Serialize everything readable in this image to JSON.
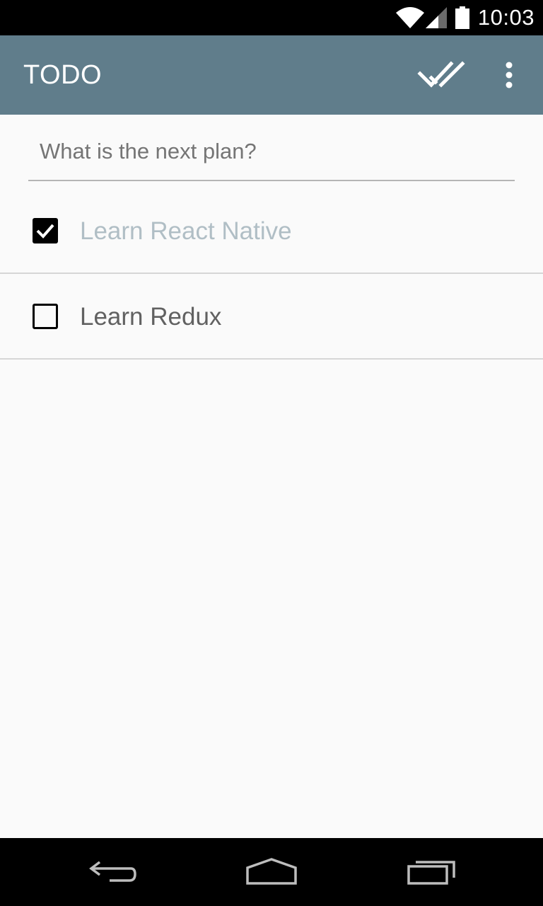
{
  "status_bar": {
    "time": "10:03",
    "icons": [
      "wifi-icon",
      "cell-signal-icon",
      "battery-icon"
    ]
  },
  "app_bar": {
    "title": "TODO",
    "actions": [
      "done-all-icon",
      "more-vert-icon"
    ]
  },
  "input": {
    "value": "",
    "placeholder": "What is the next plan?"
  },
  "todos": [
    {
      "label": "Learn React Native",
      "completed": true
    },
    {
      "label": "Learn Redux",
      "completed": false
    }
  ],
  "nav_bar": {
    "buttons": [
      "back-icon",
      "home-icon",
      "recents-icon"
    ]
  },
  "colors": {
    "app_bar": "#607d8b",
    "background": "#fafafa",
    "completed_text": "#b0bec5",
    "pending_text": "#616161",
    "divider": "#d6d6d6"
  }
}
